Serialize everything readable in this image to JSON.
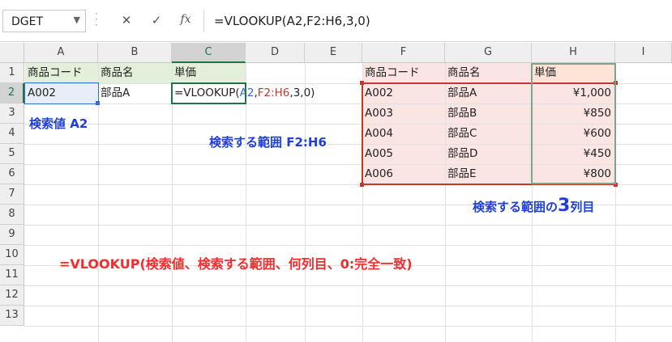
{
  "formula_bar": {
    "name_box": "DGET",
    "cancel_icon": "✕",
    "enter_icon": "✓",
    "function_icon": "fx",
    "formula": "=VLOOKUP(A2,F2:H6,3,0)"
  },
  "columns": [
    "A",
    "B",
    "C",
    "D",
    "E",
    "F",
    "G",
    "H",
    "I"
  ],
  "rows": [
    "1",
    "2",
    "3",
    "4",
    "5",
    "6",
    "7",
    "8",
    "9",
    "10",
    "11",
    "12",
    "13"
  ],
  "cells": {
    "A1": "商品コード",
    "B1": "商品名",
    "C1": "単価",
    "A2": "A002",
    "B2": "部品A",
    "C2_parts": {
      "prefix": "=VLOOKUP(",
      "arg1": "A2",
      "comma1": ",",
      "arg2": "F2:H6",
      "suffix": ",3,0)"
    },
    "F1": "商品コード",
    "G1": "商品名",
    "H1": "単価",
    "F2": "A002",
    "G2": "部品A",
    "H2": "¥1,000",
    "F3": "A003",
    "G3": "部品B",
    "H3": "¥850",
    "F4": "A004",
    "G4": "部品C",
    "H4": "¥600",
    "F5": "A005",
    "G5": "部品D",
    "H5": "¥450",
    "F6": "A006",
    "G6": "部品E",
    "H6": "¥800"
  },
  "annotations": {
    "lookup_value": "検索値 A2",
    "search_range": "検索する範囲 F2:H6",
    "third_column_pre": "検索する範囲の",
    "third_column_num": "3",
    "third_column_post": "列目",
    "syntax": "=VLOOKUP(検索値、検索する範囲、何列目、0:完全一致)"
  },
  "colors": {
    "annotation_blue": "#1f3fd9",
    "annotation_red": "#f22d2d",
    "ref_a2_blue": "#2e6ed6",
    "ref_f2h6_red": "#c0392b",
    "header_fill_green": "#e2efda",
    "table_fill_pink": "#fbe5e2",
    "selected_col_green": "#217346"
  }
}
